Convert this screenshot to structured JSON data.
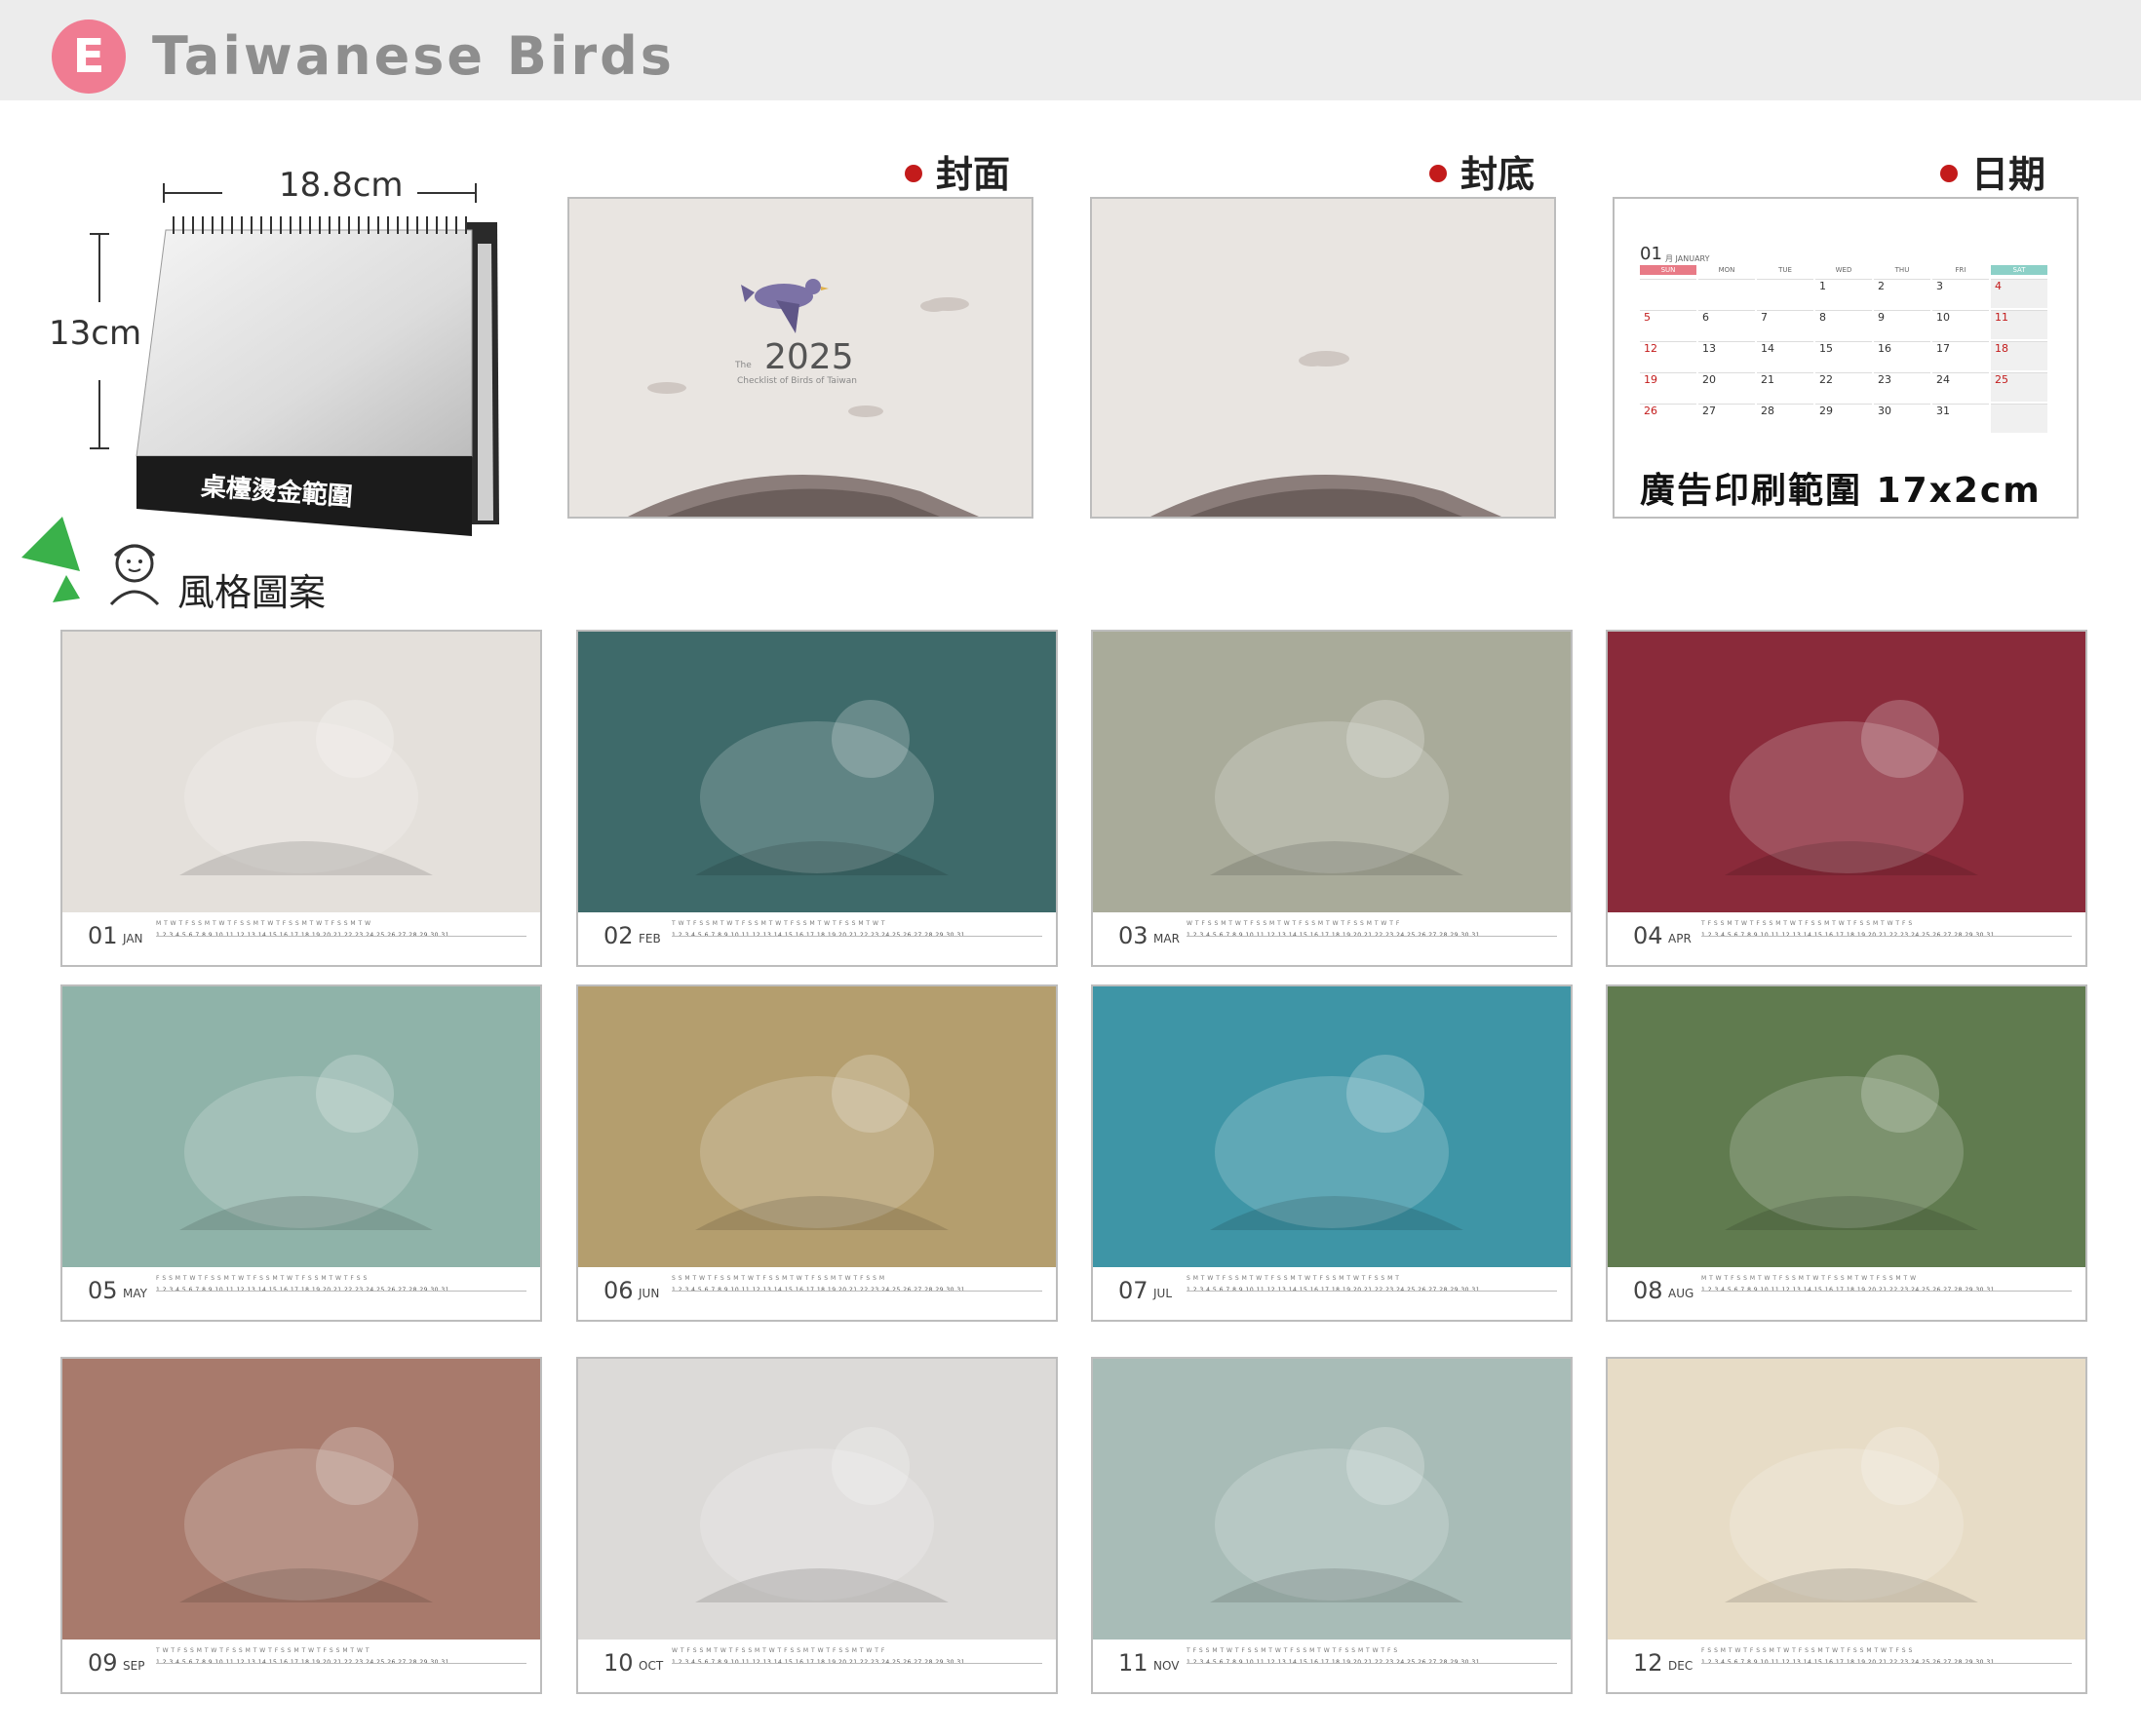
{
  "header": {
    "badge": "E",
    "title": "Taiwanese Birds"
  },
  "size": {
    "width_label": "18.8cm",
    "height_label": "13cm",
    "stamp_label": "桌檯燙金範圍"
  },
  "sections": {
    "cover": "封面",
    "back": "封底",
    "date": "日期"
  },
  "cover": {
    "the": "The",
    "year": "2025",
    "subtitle": "Checklist of Birds of Taiwan"
  },
  "calendar": {
    "month_num": "01",
    "month_name": "月 JANUARY",
    "days": [
      "SUN",
      "MON",
      "TUE",
      "WED",
      "THU",
      "FRI",
      "SAT"
    ],
    "weeks": [
      [
        "",
        "",
        "",
        "1",
        "2",
        "3",
        "4"
      ],
      [
        "5",
        "6",
        "7",
        "8",
        "9",
        "10",
        "11"
      ],
      [
        "12",
        "13",
        "14",
        "15",
        "16",
        "17",
        "18"
      ],
      [
        "19",
        "20",
        "21",
        "22",
        "23",
        "24",
        "25"
      ],
      [
        "26",
        "27",
        "28",
        "29",
        "30",
        "31",
        ""
      ]
    ],
    "ad_range": "廣告印刷範圍 17x2cm"
  },
  "style_label": "風格圖案",
  "months": [
    {
      "num": "01",
      "abbr": "JAN",
      "bg": "#e4e0db"
    },
    {
      "num": "02",
      "abbr": "FEB",
      "bg": "#3e6a6a"
    },
    {
      "num": "03",
      "abbr": "MAR",
      "bg": "#a9ab9a"
    },
    {
      "num": "04",
      "abbr": "APR",
      "bg": "#8a2a3a"
    },
    {
      "num": "05",
      "abbr": "MAY",
      "bg": "#8fb3a9"
    },
    {
      "num": "06",
      "abbr": "JUN",
      "bg": "#b49e6e"
    },
    {
      "num": "07",
      "abbr": "JUL",
      "bg": "#3e95a6"
    },
    {
      "num": "08",
      "abbr": "AUG",
      "bg": "#607b4f"
    },
    {
      "num": "09",
      "abbr": "SEP",
      "bg": "#a87a6c"
    },
    {
      "num": "10",
      "abbr": "OCT",
      "bg": "#dcdad8"
    },
    {
      "num": "11",
      "abbr": "NOV",
      "bg": "#a8bcb7"
    },
    {
      "num": "12",
      "abbr": "DEC",
      "bg": "#e7dcc6"
    }
  ],
  "colors": {
    "badge": "#f07c92",
    "accent_red": "#c31b1b",
    "calendar_sun": "#e87a86",
    "calendar_sat": "#8cd0c7"
  }
}
